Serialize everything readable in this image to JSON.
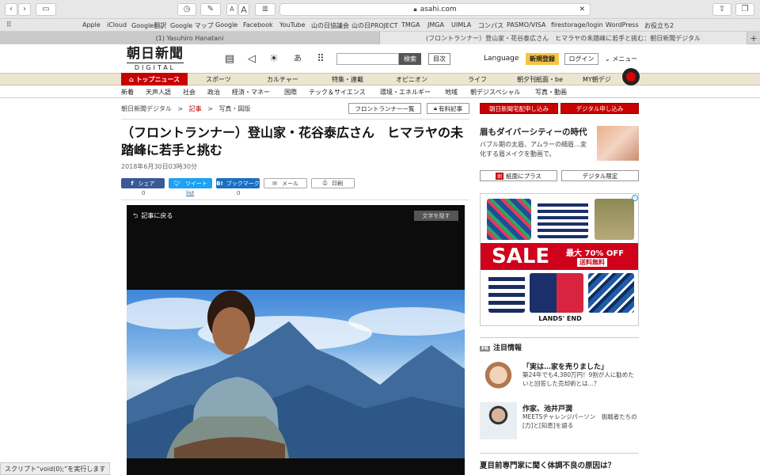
{
  "browser": {
    "url": "asahi.com",
    "favorites": [
      "Apple",
      "iCloud",
      "Google翻訳",
      "Google マップ",
      "Google",
      "Facebook",
      "YouTube",
      "山の日協議会",
      "山の日PROJECT",
      "TMGA",
      "JMGA",
      "UIMLA",
      "コンパス",
      "PASMO/VISA",
      "firestorage/login",
      "WordPress",
      "お役立ち2"
    ],
    "tabs": [
      "(1) Yasuhiro Hanatani",
      "(フロントランナー）登山家・花谷泰広さん　ヒマラヤの未踏峰に若手と挑む：朝日新聞デジタル"
    ],
    "status": "スクリプト“void(0);”を実行します"
  },
  "header": {
    "logo_title": "朝日新聞",
    "logo_sub": "DIGITAL",
    "search_button": "検索",
    "index_button": "目次",
    "language": "Language",
    "signup": "新規登録",
    "login": "ログイン",
    "menu": "メニュー"
  },
  "nav1": [
    "トップニュース",
    "スポーツ",
    "カルチャー",
    "特集・連載",
    "オピニオン",
    "ライフ",
    "朝夕刊紙面・be",
    "MY朝デジ"
  ],
  "nav2": [
    "新着",
    "天声人語",
    "社会",
    "政治",
    "経済・マネー",
    "国際",
    "テック＆サイエンス",
    "環境・エネルギー",
    "地域",
    "朝デジスペシャル",
    "写真・動画"
  ],
  "breadcrumb": {
    "root": "朝日新聞デジタル",
    "sep": ">",
    "current": "記事",
    "last": "写真・図版"
  },
  "article": {
    "frontrunner_list": "フロントランナー一覧",
    "paid": "有料記事",
    "title": "（フロントランナー）登山家・花谷泰広さん　ヒマラヤの未踏峰に若手と挑む",
    "date": "2018年6月30日03時30分",
    "share": [
      {
        "label": "シェア",
        "count": "0",
        "color": "#3b5998"
      },
      {
        "label": "ツイート",
        "count": "list",
        "color": "#1da1f2"
      },
      {
        "label": "ブックマーク",
        "count": "0",
        "color": "#1b6fc1"
      },
      {
        "label": "メール",
        "count": "",
        "color": "#ffffff"
      },
      {
        "label": "印刷",
        "count": "",
        "color": "#ffffff"
      }
    ],
    "photo_back": "記事に戻る",
    "photo_hide": "文字を隠す"
  },
  "sidebar": {
    "title": "眉もダイバーシティーの時代",
    "desc": "バブル期の太眉、アムラーの細眉…変化する眉メイクを動画で。",
    "btn1": "紙面にプラス",
    "btn2": "デジタル限定",
    "ad": {
      "sale": "SALE",
      "max": "最大 70% OFF",
      "ship": "送料無料",
      "brand": "LANDS' END"
    },
    "pr_header": "注目情報",
    "pr_label": "PR",
    "pr_items": [
      {
        "title": "「実は…家を売りました」",
        "desc": "築24年でも4,380万円！9割が人に勧めたいと回答した売却術とは…？"
      },
      {
        "title": "作家、池井戸潤",
        "desc": "MEETSチャレンジパーソン　挑戦者たちの[力]と[知恵]を語る"
      }
    ],
    "bottom_title": "夏目前専門家に聞く体調不良の原因は？"
  },
  "top_buttons": {
    "newspaper": "朝日新聞宅配申し込み",
    "digital": "デジタル申し込み"
  }
}
